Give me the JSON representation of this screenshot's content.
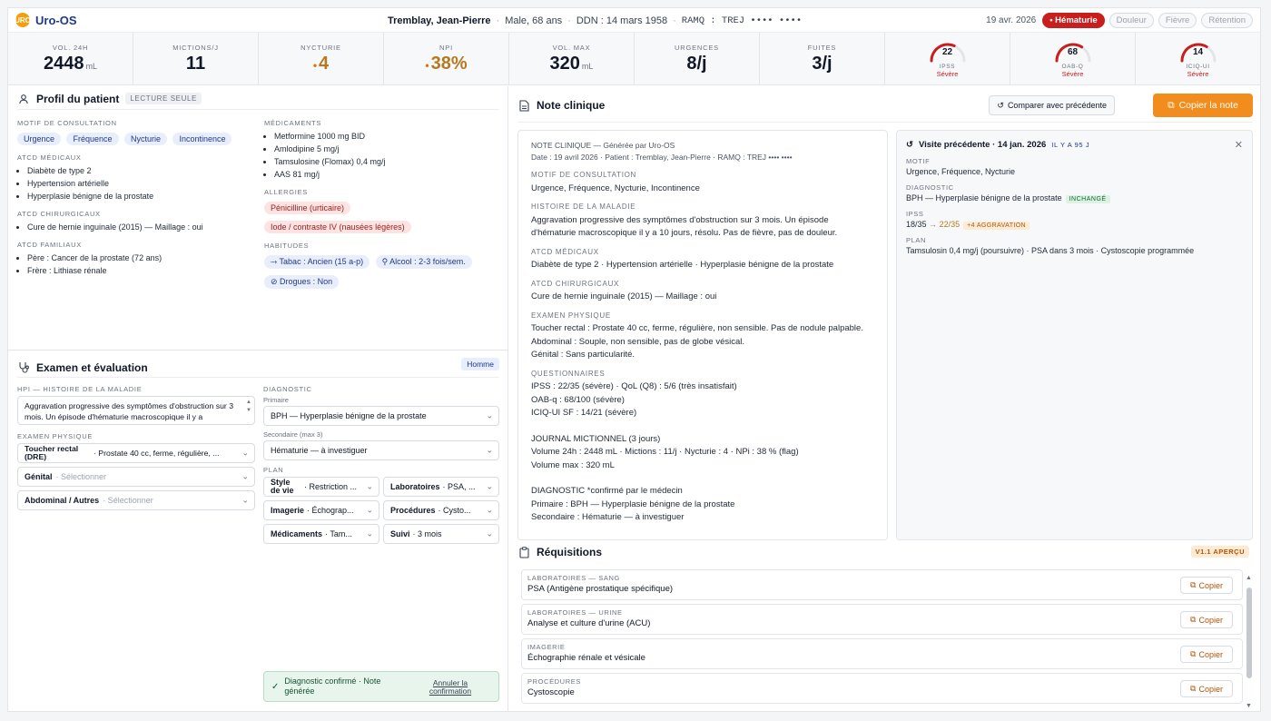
{
  "app": {
    "name": "Uro-OS",
    "logo_text": "URO"
  },
  "patient": {
    "name": "Tremblay, Jean-Pierre",
    "sex_age": "Male, 68 ans",
    "ddn": "DDN : 14 mars 1958",
    "ramq": "RAMQ : TREJ •••• ••••"
  },
  "header": {
    "date": "19 avr. 2026",
    "chips": [
      {
        "label": "• Hématurie",
        "active": true
      },
      {
        "label": "Douleur",
        "active": false
      },
      {
        "label": "Fièvre",
        "active": false
      },
      {
        "label": "Rétention",
        "active": false
      }
    ]
  },
  "metrics": [
    {
      "label": "VOL. 24H",
      "value": "2448",
      "unit": "mL",
      "flag": false
    },
    {
      "label": "MICTIONS/J",
      "value": "11",
      "unit": "",
      "flag": false
    },
    {
      "label": "NYCTURIE",
      "value": "4",
      "unit": "",
      "flag": true
    },
    {
      "label": "NPI",
      "value": "38%",
      "unit": "",
      "flag": true
    },
    {
      "label": "VOL. MAX",
      "value": "320",
      "unit": "mL",
      "flag": false
    },
    {
      "label": "URGENCES",
      "value": "8/j",
      "unit": "",
      "flag": false
    },
    {
      "label": "FUITES",
      "value": "3/j",
      "unit": "",
      "flag": false
    }
  ],
  "gauges": [
    {
      "value": "22",
      "name": "IPSS",
      "severity": "Sévère",
      "fraction": 0.63
    },
    {
      "value": "68",
      "name": "OAB-Q",
      "severity": "Sévère",
      "fraction": 0.68
    },
    {
      "value": "14",
      "name": "ICIQ-UI",
      "severity": "Sévère",
      "fraction": 0.67
    }
  ],
  "profile": {
    "title": "Profil du patient",
    "tag": "LECTURE SEULE",
    "motif_label": "MOTIF DE CONSULTATION",
    "motifs": [
      "Urgence",
      "Fréquence",
      "Nycturie",
      "Incontinence"
    ],
    "atcd_med_label": "ATCD MÉDICAUX",
    "atcd_med": [
      "Diabète de type 2",
      "Hypertension artérielle",
      "Hyperplasie bénigne de la prostate"
    ],
    "atcd_chir_label": "ATCD CHIRURGICAUX",
    "atcd_chir": [
      "Cure de hernie inguinale (2015) — Maillage : oui"
    ],
    "atcd_fam_label": "ATCD FAMILIAUX",
    "atcd_fam": [
      "Père : Cancer de la prostate (72 ans)",
      "Frère : Lithiase rénale"
    ],
    "med_label": "MÉDICAMENTS",
    "meds": [
      "Metformine 1000 mg BID",
      "Amlodipine 5 mg/j",
      "Tamsulosine (Flomax) 0,4 mg/j",
      "AAS 81 mg/j"
    ],
    "allergies_label": "ALLERGIES",
    "allergies": [
      "Pénicilline (urticaire)",
      "Iode / contraste IV (nausées légères)"
    ],
    "habits_label": "HABITUDES",
    "habits": [
      "Tabac : Ancien (15 a-p)",
      "Alcool : 2-3 fois/sem.",
      "Drogues : Non"
    ]
  },
  "exam": {
    "title": "Examen et évaluation",
    "badge": "Homme",
    "hpi_label": "HPI — HISTOIRE DE LA MALADIE",
    "hpi_text": "Aggravation progressive des symptômes d'obstruction sur 3 mois. Un épisode d'hématurie macroscopique il y a",
    "exam_label": "EXAMEN PHYSIQUE",
    "exam_rows": [
      {
        "name": "Toucher rectal (DRE)",
        "value": "· Prostate 40 cc, ferme, régulière, ...",
        "muted": false
      },
      {
        "name": "Génital",
        "value": "· Sélectionner",
        "muted": true
      },
      {
        "name": "Abdominal / Autres",
        "value": "· Sélectionner",
        "muted": true
      }
    ],
    "diag_label": "DIAGNOSTIC",
    "primary_label": "Primaire",
    "primary_value": "BPH — Hyperplasie bénigne de la prostate",
    "secondary_label": "Secondaire (max 3)",
    "secondary_value": "Hématurie — à investiguer",
    "plan_label": "PLAN",
    "plan": [
      {
        "name": "Style de vie",
        "value": "· Restriction ..."
      },
      {
        "name": "Laboratoires",
        "value": "· PSA, ..."
      },
      {
        "name": "Imagerie",
        "value": "· Échograp..."
      },
      {
        "name": "Procédures",
        "value": "· Cysto..."
      },
      {
        "name": "Médicaments",
        "value": "· Tam..."
      },
      {
        "name": "Suivi",
        "value": "· 3 mois"
      }
    ],
    "confirm_text": "Diagnostic confirmé · Note générée",
    "undo_label": "Annuler la confirmation"
  },
  "note": {
    "title": "Note clinique",
    "compare_label": "Comparer avec précédente",
    "copy_label": "Copier la note",
    "header_line": "NOTE CLINIQUE — Générée par Uro-OS",
    "meta_line": "Date : 19 avril 2026 · Patient : Tremblay, Jean-Pierre · RAMQ : TREJ •••• ••••",
    "sections": [
      {
        "label": "MOTIF DE CONSULTATION",
        "lines": [
          "Urgence, Fréquence, Nycturie, Incontinence"
        ]
      },
      {
        "label": "HISTOIRE DE LA MALADIE",
        "lines": [
          "Aggravation progressive des symptômes d'obstruction sur 3 mois. Un épisode d'hématurie macroscopique il y a 10 jours, résolu. Pas de fièvre, pas de douleur."
        ]
      },
      {
        "label": "ATCD MÉDICAUX",
        "lines": [
          "Diabète de type 2 · Hypertension artérielle · Hyperplasie bénigne de la prostate"
        ]
      },
      {
        "label": "ATCD CHIRURGICAUX",
        "lines": [
          "Cure de hernie inguinale (2015) — Maillage : oui"
        ]
      },
      {
        "label": "EXAMEN PHYSIQUE",
        "lines": [
          "Toucher rectal : Prostate 40 cc, ferme, régulière, non sensible. Pas de nodule palpable.",
          "Abdominal : Souple, non sensible, pas de globe vésical.",
          "Génital : Sans particularité."
        ]
      },
      {
        "label": "QUESTIONNAIRES",
        "lines": [
          "IPSS : 22/35 (sévère) · QoL (Q8) : 5/6 (très insatisfait)",
          "OAB-q : 68/100 (sévère)",
          "ICIQ-UI SF : 14/21 (sévère)",
          " ",
          "JOURNAL MICTIONNEL (3 jours)",
          "Volume 24h : 2448 mL · Mictions : 11/j · Nycturie : 4 · NPi : 38 % (flag)",
          "Volume max : 320 mL",
          " ",
          "DIAGNOSTIC *confirmé par le médecin",
          "Primaire : BPH — Hyperplasie bénigne de la prostate",
          "Secondaire : Hématurie — à investiguer"
        ]
      }
    ]
  },
  "previous": {
    "title": "Visite précédente · 14 jan. 2026",
    "ago": "IL Y A 95 J",
    "motif_label": "MOTIF",
    "motif": "Urgence, Fréquence, Nycturie",
    "diag_label": "DIAGNOSTIC",
    "diag": "BPH — Hyperplasie bénigne de la prostate",
    "diag_badge": "INCHANGÉ",
    "ipss_label": "IPSS",
    "ipss_old": "18/35",
    "ipss_arrow": "→",
    "ipss_new": "22/35",
    "ipss_badge": "+4 AGGRAVATION",
    "plan_label": "PLAN",
    "plan": "Tamsulosin 0,4 mg/j (poursuivre) · PSA dans 3 mois · Cystoscopie programmée"
  },
  "requisitions": {
    "title": "Réquisitions",
    "badge": "V1.1 APERÇU",
    "copy_label": "Copier",
    "items": [
      {
        "label": "LABORATOIRES — SANG",
        "value": "PSA (Antigène prostatique spécifique)"
      },
      {
        "label": "LABORATOIRES — URINE",
        "value": "Analyse et culture d'urine (ACU)"
      },
      {
        "label": "IMAGERIE",
        "value": "Échographie rénale et vésicale"
      },
      {
        "label": "PROCÉDURES",
        "value": "Cystoscopie"
      }
    ]
  },
  "colors": {
    "accent": "#f28c1c",
    "danger": "#c81e1e",
    "brand": "#1e3a8a",
    "warn": "#b7791f"
  }
}
